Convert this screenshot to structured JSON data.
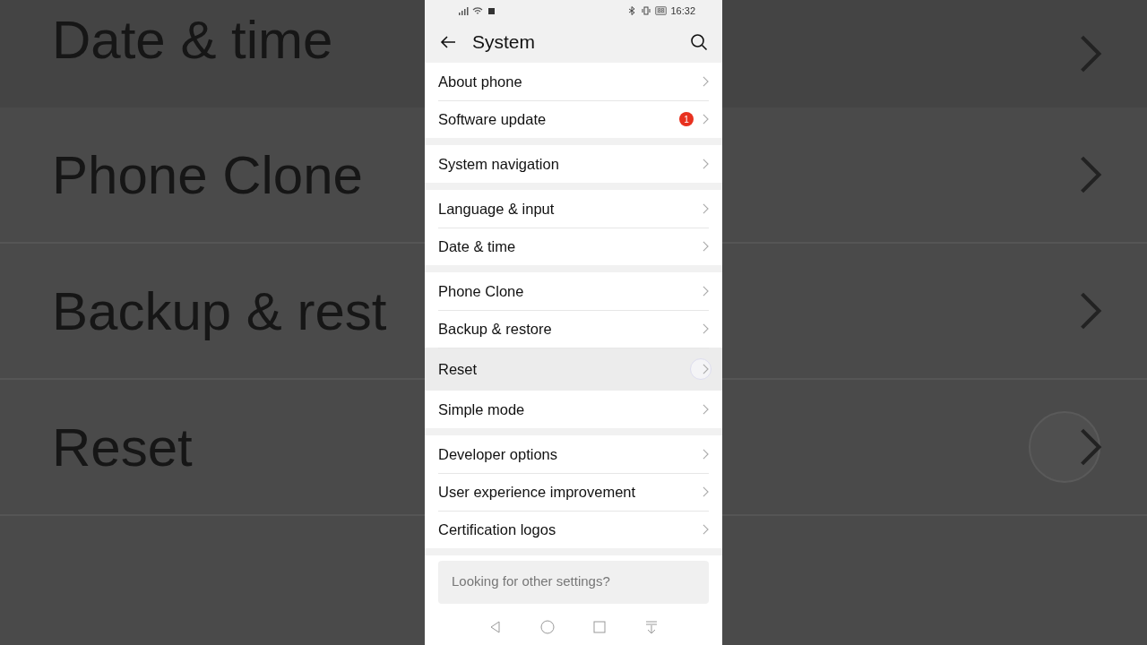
{
  "backdrop": {
    "left_items": [
      {
        "label": "Date & time"
      },
      {
        "label": "Phone Clone"
      },
      {
        "label": "Backup & rest"
      },
      {
        "label": "Reset"
      }
    ],
    "right_items": [
      {
        "pressed": false
      },
      {
        "pressed": false
      },
      {
        "pressed": false
      },
      {
        "pressed": true
      }
    ]
  },
  "status_bar": {
    "battery": "88",
    "time": "16:32"
  },
  "header": {
    "title": "System"
  },
  "groups": [
    {
      "rows": [
        {
          "label": "About phone",
          "pressed": false
        },
        {
          "label": "Software update",
          "badge": "1",
          "pressed": false
        }
      ]
    },
    {
      "rows": [
        {
          "label": "System navigation",
          "pressed": false
        }
      ]
    },
    {
      "rows": [
        {
          "label": "Language & input",
          "pressed": false
        },
        {
          "label": "Date & time",
          "pressed": false
        }
      ]
    },
    {
      "rows": [
        {
          "label": "Phone Clone",
          "pressed": false
        },
        {
          "label": "Backup & restore",
          "pressed": false
        },
        {
          "label": "Reset",
          "pressed": true
        },
        {
          "label": "Simple mode",
          "pressed": false
        }
      ]
    },
    {
      "rows": [
        {
          "label": "Developer options",
          "pressed": false
        },
        {
          "label": "User experience improvement",
          "pressed": false
        },
        {
          "label": "Certification logos",
          "pressed": false
        }
      ]
    }
  ],
  "suggestion": {
    "title": "Looking for other settings?"
  }
}
